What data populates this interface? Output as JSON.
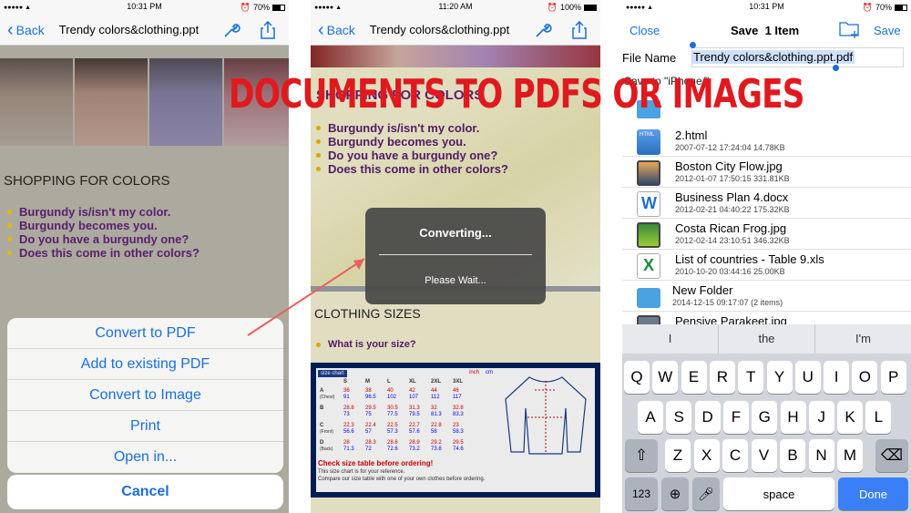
{
  "headline": "DOCUMENTS TO PDFS OR IMAGES",
  "colors": {
    "accent": "#1a6fdb",
    "headline": "#e0191f",
    "bullet_text": "#5a1e6e",
    "done": "#3a7ff6"
  },
  "panel1": {
    "status": {
      "time": "10:31 PM",
      "battery": "70%",
      "battery_level": 0.7
    },
    "nav": {
      "back": "Back",
      "title": "Trendy colors&clothing.ppt"
    },
    "doc": {
      "heading": "SHOPPING FOR COLORS",
      "bullets": [
        "Burgundy is/isn't my color.",
        "Burgundy becomes you.",
        "Do you have a burgundy one?",
        "Does this come in other colors?"
      ]
    },
    "action_sheet": {
      "options": [
        "Convert to PDF",
        "Add to existing PDF",
        "Convert to Image",
        "Print",
        "Open in..."
      ],
      "cancel": "Cancel"
    }
  },
  "panel2": {
    "status": {
      "time": "11:20 AM",
      "battery": "100%",
      "battery_level": 1.0
    },
    "nav": {
      "back": "Back",
      "title": "Trendy colors&clothing.ppt"
    },
    "doc": {
      "heading": "SHOPPING FOR COLORS",
      "bullets": [
        "Burgundy is/isn't my color.",
        "Burgundy becomes you.",
        "Do you have a burgundy one?",
        "Does this come in other colors?"
      ],
      "heading2": "CLOTHING SIZES",
      "bullets2": [
        "What is your size?"
      ]
    },
    "hud": {
      "title": "Converting...",
      "subtitle": "Please Wait..."
    },
    "size_chart": {
      "label": "size chart",
      "units": [
        "inch",
        "cm"
      ],
      "columns": [
        "S",
        "M",
        "L",
        "XL",
        "2XL",
        "3XL"
      ],
      "rows": [
        {
          "label": "A",
          "sub": "(Chest)",
          "inch": [
            "36",
            "38",
            "40",
            "42",
            "44",
            "46"
          ],
          "cm": [
            "91",
            "96.5",
            "102",
            "107",
            "112",
            "117"
          ]
        },
        {
          "label": "B",
          "sub": "",
          "inch": [
            "28.8",
            "29.5",
            "30.5",
            "31.3",
            "32",
            "32.8"
          ],
          "cm": [
            "73",
            "75",
            "77.5",
            "79.5",
            "81.3",
            "83.3"
          ]
        },
        {
          "label": "C",
          "sub": "(Front)",
          "inch": [
            "22.3",
            "22.4",
            "22.5",
            "22.7",
            "22.8",
            "23"
          ],
          "cm": [
            "56.6",
            "57",
            "57.3",
            "57.6",
            "58",
            "58.3"
          ]
        },
        {
          "label": "D",
          "sub": "(Back)",
          "inch": [
            "28",
            "28.3",
            "28.6",
            "28.9",
            "29.2",
            "29.5"
          ],
          "cm": [
            "71.3",
            "72",
            "72.6",
            "73.2",
            "73.8",
            "74.6"
          ]
        }
      ],
      "note1": "Check size table before ordering!",
      "note2": "This size chart is for your reference.",
      "note3": "Compare our size table with one of your own clothes before ordering."
    }
  },
  "panel3": {
    "status": {
      "time": "10:31 PM",
      "battery": "70%",
      "battery_level": 0.7
    },
    "nav": {
      "close": "Close",
      "title": "Save  1 Item",
      "save": "Save"
    },
    "file_name_label": "File Name",
    "file_name_value": "Trendy colors&clothing.ppt.pdf",
    "save_to": "Save to \"iPhone/\"",
    "files": [
      {
        "name": "2.html",
        "meta": "2007-07-12 17:24:04  14.78KB",
        "icon": "html-file-icon"
      },
      {
        "name": "Boston City Flow.jpg",
        "meta": "2012-01-07 17:50:15  331.81KB",
        "icon": "image-file-icon"
      },
      {
        "name": "Business Plan 4.docx",
        "meta": "2012-02-21 04:40:22  175.32KB",
        "icon": "word-file-icon"
      },
      {
        "name": "Costa Rican Frog.jpg",
        "meta": "2012-02-14 23:10:51  346.32KB",
        "icon": "image-file-icon"
      },
      {
        "name": "List of countries - Table 9.xls",
        "meta": "2010-10-20 03:44:16  25.00KB",
        "icon": "excel-file-icon"
      },
      {
        "name": "New Folder",
        "meta": "2014-12-15 09:17:07 (2 items)",
        "icon": "folder-icon"
      },
      {
        "name": "Pensive Parakeet.jpg",
        "meta": "",
        "icon": "image-file-icon"
      }
    ],
    "keyboard": {
      "suggestions": [
        "I",
        "the",
        "I'm"
      ],
      "row1": [
        "Q",
        "W",
        "E",
        "R",
        "T",
        "Y",
        "U",
        "I",
        "O",
        "P"
      ],
      "row2": [
        "A",
        "S",
        "D",
        "F",
        "G",
        "H",
        "J",
        "K",
        "L"
      ],
      "row3": [
        "Z",
        "X",
        "C",
        "V",
        "B",
        "N",
        "M"
      ],
      "numbers": "123",
      "space": "space",
      "done": "Done"
    }
  }
}
